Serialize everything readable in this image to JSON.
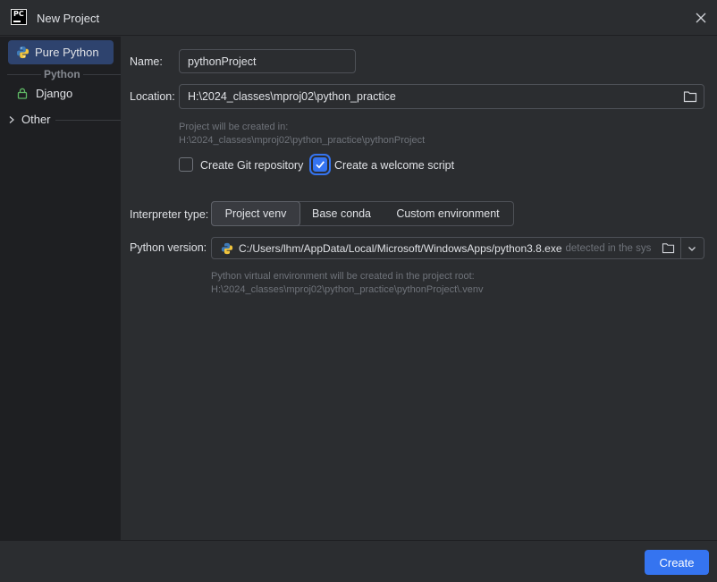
{
  "window": {
    "title": "New Project",
    "app_icon_text": "PC"
  },
  "sidebar": {
    "items": [
      {
        "label": "Pure Python",
        "icon": "python-icon",
        "selected": true
      },
      {
        "label": "Django",
        "icon": "lock-icon",
        "selected": false
      }
    ],
    "group_label": "Python",
    "other_label": "Other"
  },
  "form": {
    "name_label": "Name:",
    "name_value": "pythonProject",
    "location_label": "Location:",
    "location_value": "H:\\2024_classes\\mproj02\\python_practice",
    "project_hint_line1": "Project will be created in:",
    "project_hint_line2": "H:\\2024_classes\\mproj02\\python_practice\\pythonProject",
    "git_checkbox_label": "Create Git repository",
    "git_checked": false,
    "welcome_checkbox_label": "Create a welcome script",
    "welcome_checked": true,
    "interpreter_label": "Interpreter type:",
    "interpreter_options": [
      "Project venv",
      "Base conda",
      "Custom environment"
    ],
    "interpreter_selected": "Project venv",
    "python_version_label": "Python version:",
    "python_version_value": "C:/Users/lhm/AppData/Local/Microsoft/WindowsApps/python3.8.exe",
    "python_version_suffix": "detected in the sys",
    "venv_hint_line1": "Python virtual environment will be created in the project root:",
    "venv_hint_line2": "H:\\2024_classes\\mproj02\\python_practice\\pythonProject\\.venv"
  },
  "footer": {
    "create_label": "Create"
  },
  "colors": {
    "accent": "#3574f0",
    "background": "#2b2d30",
    "sidebar_bg": "#1e1f22",
    "selection": "#2e436e"
  }
}
